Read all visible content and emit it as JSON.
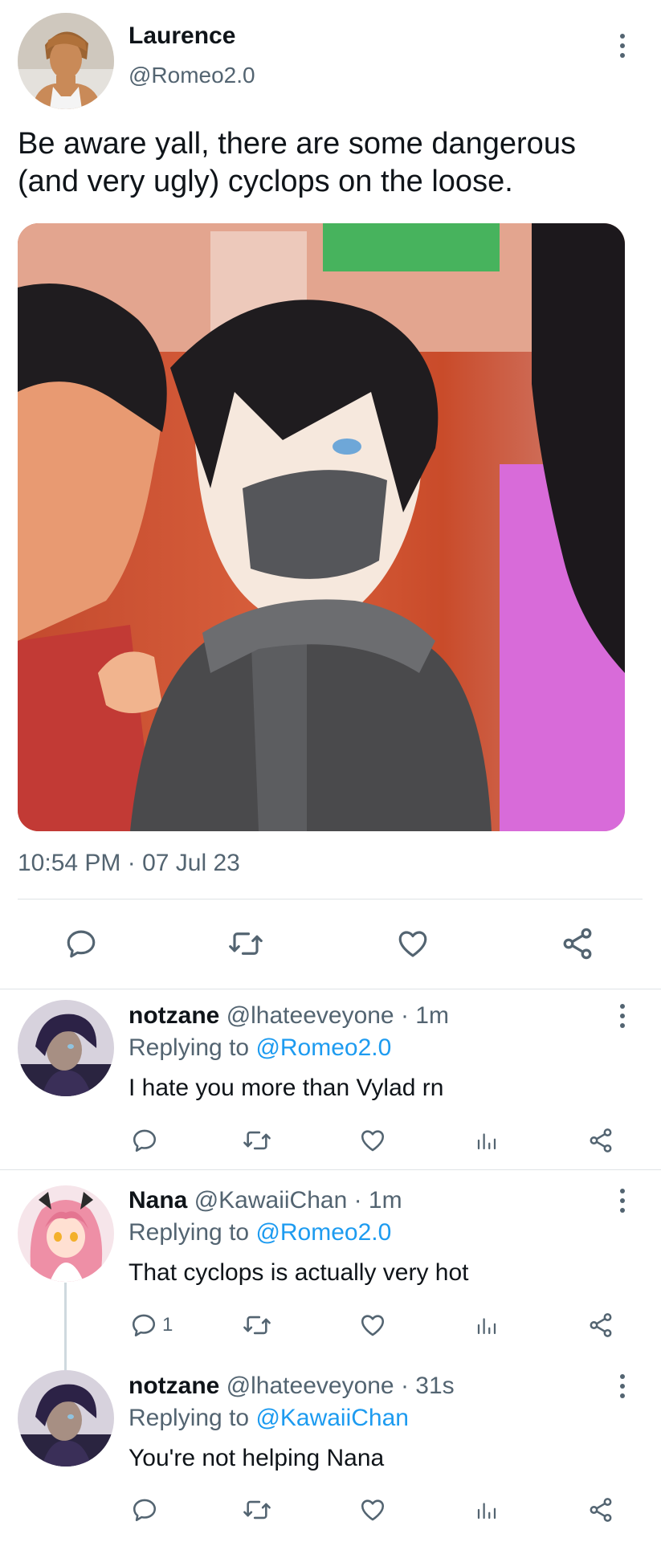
{
  "main_tweet": {
    "author_name": "Laurence",
    "author_handle": "@Romeo2.0",
    "text": "Be aware yall, there are some dangerous (and very ugly) cyclops on the loose.",
    "timestamp": "10:54 PM · 07 Jul 23",
    "actions": [
      "reply-icon",
      "retweet-icon",
      "like-icon",
      "share-icon"
    ]
  },
  "replies": [
    {
      "author_name": "notzane",
      "author_handle": "@lhateeveyone · 1m",
      "replying_prefix": "Replying to",
      "replying_to": "@Romeo2.0",
      "text": "I hate you more than Vylad rn",
      "reply_count": ""
    },
    {
      "author_name": "Nana",
      "author_handle": "@KawaiiChan · 1m",
      "replying_prefix": "Replying to",
      "replying_to": "@Romeo2.0",
      "text": "That cyclops is actually very hot",
      "reply_count": "1"
    },
    {
      "author_name": "notzane",
      "author_handle": "@lhateeveyone · 31s",
      "replying_prefix": "Replying to",
      "replying_to": "@KawaiiChan",
      "text": "You're not helping Nana",
      "reply_count": ""
    }
  ],
  "colors": {
    "accent": "#1d9bf0",
    "secondary_text": "#536471",
    "divider": "#dfe3e6"
  }
}
